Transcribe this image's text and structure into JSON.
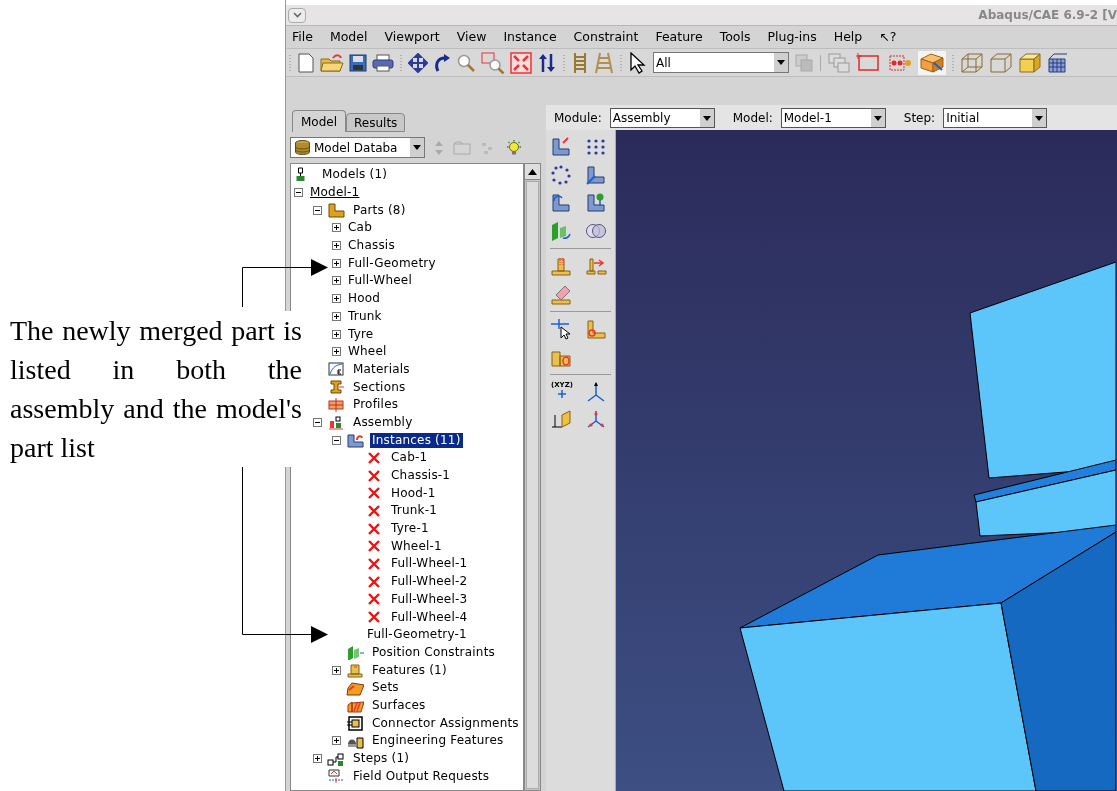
{
  "annotation": {
    "text": "The newly merged part is listed in both the assembly and the model's part list"
  },
  "window": {
    "title": "Abaqus/CAE 6.9-2 [V"
  },
  "menu": [
    {
      "label": "File"
    },
    {
      "label": "Model"
    },
    {
      "label": "Viewport"
    },
    {
      "label": "View"
    },
    {
      "label": "Instance"
    },
    {
      "label": "Constraint"
    },
    {
      "label": "Feature"
    },
    {
      "label": "Tools"
    },
    {
      "label": "Plug-ins"
    },
    {
      "label": "Help"
    },
    {
      "label": "↖?"
    }
  ],
  "toolbox": {
    "datum_label": "(XYZ)"
  },
  "toolbar": {
    "selection_filter": "All"
  },
  "tabs": [
    {
      "label": "Model",
      "selected": true
    },
    {
      "label": "Results",
      "selected": false
    }
  ],
  "context_bar": [
    {
      "label": "Module:",
      "value": "Assembly"
    },
    {
      "label": "Model:",
      "value": "Model-1"
    },
    {
      "label": "Step:",
      "value": "Initial"
    }
  ],
  "tree_source": "Model Databa",
  "tree": [
    {
      "label": "Models (1)",
      "kind": "models",
      "selected": false
    },
    {
      "label": "Model-1",
      "kind": "model",
      "expanded": true,
      "selected": false,
      "children": [
        {
          "label": "Parts (8)",
          "kind": "parts",
          "expanded": true,
          "selected": false,
          "children": [
            {
              "label": "Cab",
              "kind": "part",
              "expanded": false,
              "selected": false
            },
            {
              "label": "Chassis",
              "kind": "part",
              "expanded": false,
              "selected": false
            },
            {
              "label": "Full-Geometry",
              "kind": "part",
              "expanded": false,
              "selected": false
            },
            {
              "label": "Full-Wheel",
              "kind": "part",
              "expanded": false,
              "selected": false
            },
            {
              "label": "Hood",
              "kind": "part",
              "expanded": false,
              "selected": false
            },
            {
              "label": "Trunk",
              "kind": "part",
              "expanded": false,
              "selected": false
            },
            {
              "label": "Tyre",
              "kind": "part",
              "expanded": false,
              "selected": false
            },
            {
              "label": "Wheel",
              "kind": "part",
              "expanded": false,
              "selected": false
            }
          ]
        },
        {
          "label": "Materials",
          "kind": "materials",
          "selected": false
        },
        {
          "label": "Sections",
          "kind": "sections",
          "selected": false
        },
        {
          "label": "Profiles",
          "kind": "profiles",
          "selected": false
        },
        {
          "label": "Assembly",
          "kind": "assembly",
          "expanded": true,
          "selected": false,
          "children": [
            {
              "label": "Instances (11)",
              "kind": "instances",
              "expanded": true,
              "selected": true,
              "children": [
                {
                  "label": "Cab-1",
                  "kind": "instance-failed",
                  "selected": false
                },
                {
                  "label": "Chassis-1",
                  "kind": "instance-failed",
                  "selected": false
                },
                {
                  "label": "Hood-1",
                  "kind": "instance-failed",
                  "selected": false
                },
                {
                  "label": "Trunk-1",
                  "kind": "instance-failed",
                  "selected": false
                },
                {
                  "label": "Tyre-1",
                  "kind": "instance-failed",
                  "selected": false
                },
                {
                  "label": "Wheel-1",
                  "kind": "instance-failed",
                  "selected": false
                },
                {
                  "label": "Full-Wheel-1",
                  "kind": "instance-failed",
                  "selected": false
                },
                {
                  "label": "Full-Wheel-2",
                  "kind": "instance-failed",
                  "selected": false
                },
                {
                  "label": "Full-Wheel-3",
                  "kind": "instance-failed",
                  "selected": false
                },
                {
                  "label": "Full-Wheel-4",
                  "kind": "instance-failed",
                  "selected": false
                },
                {
                  "label": "Full-Geometry-1",
                  "kind": "instance",
                  "selected": false
                }
              ]
            },
            {
              "label": "Position Constraints",
              "kind": "constraints",
              "selected": false
            },
            {
              "label": "Features (1)",
              "kind": "features",
              "expanded": false,
              "selected": false
            },
            {
              "label": "Sets",
              "kind": "sets",
              "selected": false
            },
            {
              "label": "Surfaces",
              "kind": "surfaces",
              "selected": false
            },
            {
              "label": "Connector Assignments",
              "kind": "connectors",
              "selected": false
            },
            {
              "label": "Engineering Features",
              "kind": "engineering",
              "expanded": false,
              "selected": false
            }
          ]
        },
        {
          "label": "Steps (1)",
          "kind": "steps",
          "expanded": false,
          "selected": false
        },
        {
          "label": "Field Output Requests",
          "kind": "field-output",
          "selected": false
        }
      ]
    }
  ]
}
